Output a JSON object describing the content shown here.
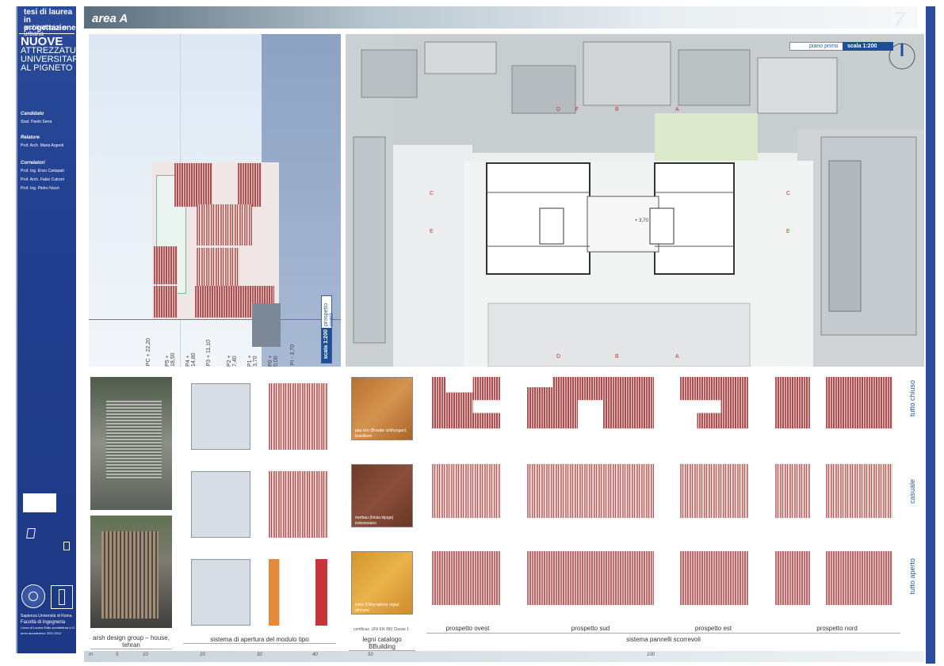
{
  "sidebar": {
    "thesis_line1": "tesi di laurea",
    "thesis_line2": "in progettazione",
    "thesis_line3": "architettonica e urbana",
    "title_line1": "NUOVE",
    "title_line2": "ATTREZZATURE",
    "title_line3": "UNIVERSITARIE",
    "title_line4": "AL PIGNETO",
    "candidate_heading": "Candidato",
    "candidate_name": "Stud. Paolo Serra",
    "advisor_heading": "Relatore",
    "advisor_name": "Prof. Arch. Maria Argenti",
    "coadvisors_heading": "Correlatori",
    "coadvisors": [
      "Prof. Ing. Enzo Cartapati",
      "Prof. Arch. Fabio Cutroni",
      "Prof. Ing. Pietro Nozzi"
    ],
    "university_line1": "Sapienza Università di Roma",
    "university_line2": "Facoltà di Ingegneria",
    "university_line3": "Corso di Laurea Edile-Architettura U.E.",
    "university_line4": "anno accademico 2011-2012"
  },
  "header": {
    "area_title": "area A",
    "page_number": "7"
  },
  "elevation": {
    "label": "prospetto ovest",
    "scale": "scala 1:200",
    "levels": [
      "PC + 22,20",
      "P5 + 18,50",
      "P4 + 14,80",
      "P3 + 11,10",
      "P2 + 7,40",
      "P1 + 3,70",
      "P0 + 0,00",
      "PI - 3,70"
    ]
  },
  "plan": {
    "label": "piano primo",
    "scale": "scala 1:200",
    "level_mark": "+ 3,70",
    "sections_top": [
      "D",
      "F",
      "B",
      "A"
    ],
    "sections_bottom": [
      "D",
      "B",
      "A"
    ],
    "sections_left": [
      "C",
      "E"
    ],
    "sections_right": [
      "C",
      "E"
    ]
  },
  "bottom": {
    "photo_caption": "arsh design group – house, tehran",
    "opening_caption": "sistema di apertura del modulo tipo",
    "wood_cert": "certificaz. UNI EN 350 Classe 1",
    "wood_caption": "legni catalogo BBuilding",
    "woods": [
      {
        "name": "pau ciro (Bowdie ichthyogan)",
        "origin": "brasiliano"
      },
      {
        "name": "merbau (Intsia bijuga)",
        "origin": "indonesiano"
      },
      {
        "name": "iroko (Chlorophora regia)",
        "origin": "africano"
      }
    ],
    "states": [
      "tutto chiuso",
      "casuale",
      "tutto aperto"
    ],
    "prospetti": [
      "prospetto ovest",
      "prospetto sud",
      "prospetto est",
      "prospetto nord"
    ],
    "panels_caption": "sistema pannelli scorrevoli"
  },
  "ruler": {
    "unit": "m",
    "ticks": [
      "5",
      "10",
      "20",
      "30",
      "40",
      "50",
      "100"
    ]
  },
  "colors": {
    "sidebar_blue": "#213f8f",
    "brick_red": "#b2585f",
    "accent_blue": "#2d5ba6"
  }
}
